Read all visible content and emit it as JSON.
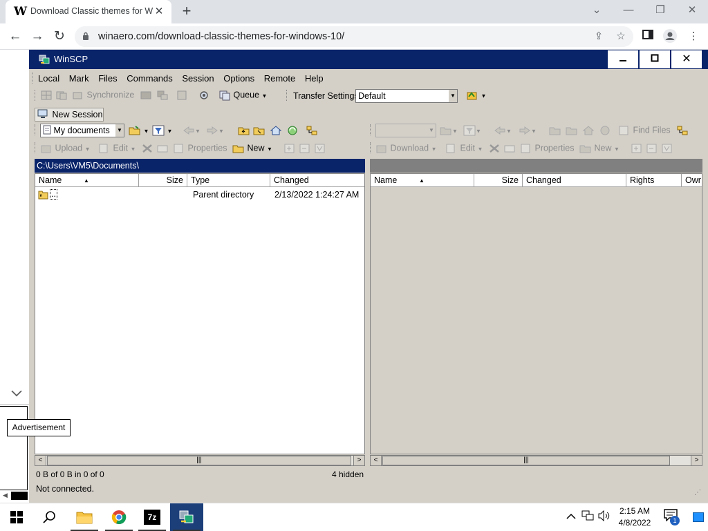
{
  "browser": {
    "tab_title": "Download Classic themes for Wi",
    "tab_favicon": "W",
    "url": "winaero.com/download-classic-themes-for-windows-10/"
  },
  "page": {
    "ad_label": "Advertisement"
  },
  "winscp": {
    "title": "WinSCP",
    "menu": [
      "Local",
      "Mark",
      "Files",
      "Commands",
      "Session",
      "Options",
      "Remote",
      "Help"
    ],
    "toolbar": {
      "synchronize": "Synchronize",
      "queue": "Queue",
      "transfer_settings_label": "Transfer Settings",
      "transfer_settings_value": "Default"
    },
    "new_session": "New Session",
    "left": {
      "location": "My documents",
      "upload": "Upload",
      "edit": "Edit",
      "properties": "Properties",
      "new": "New",
      "path": "C:\\Users\\VM5\\Documents\\",
      "columns": [
        "Name",
        "Size",
        "Type",
        "Changed"
      ],
      "rows": [
        {
          "name": "..",
          "size": "",
          "type": "Parent directory",
          "changed": "2/13/2022  1:24:27 AM"
        }
      ]
    },
    "right": {
      "find_files": "Find Files",
      "download": "Download",
      "edit": "Edit",
      "properties": "Properties",
      "new": "New",
      "columns": [
        "Name",
        "Size",
        "Changed",
        "Rights",
        "Owr"
      ]
    },
    "status": {
      "selection": "0 B of 0 B in 0 of 0",
      "hidden": "4 hidden",
      "connection": "Not connected."
    }
  },
  "taskbar": {
    "time": "2:15 AM",
    "date": "4/8/2022",
    "notification_count": "1"
  }
}
